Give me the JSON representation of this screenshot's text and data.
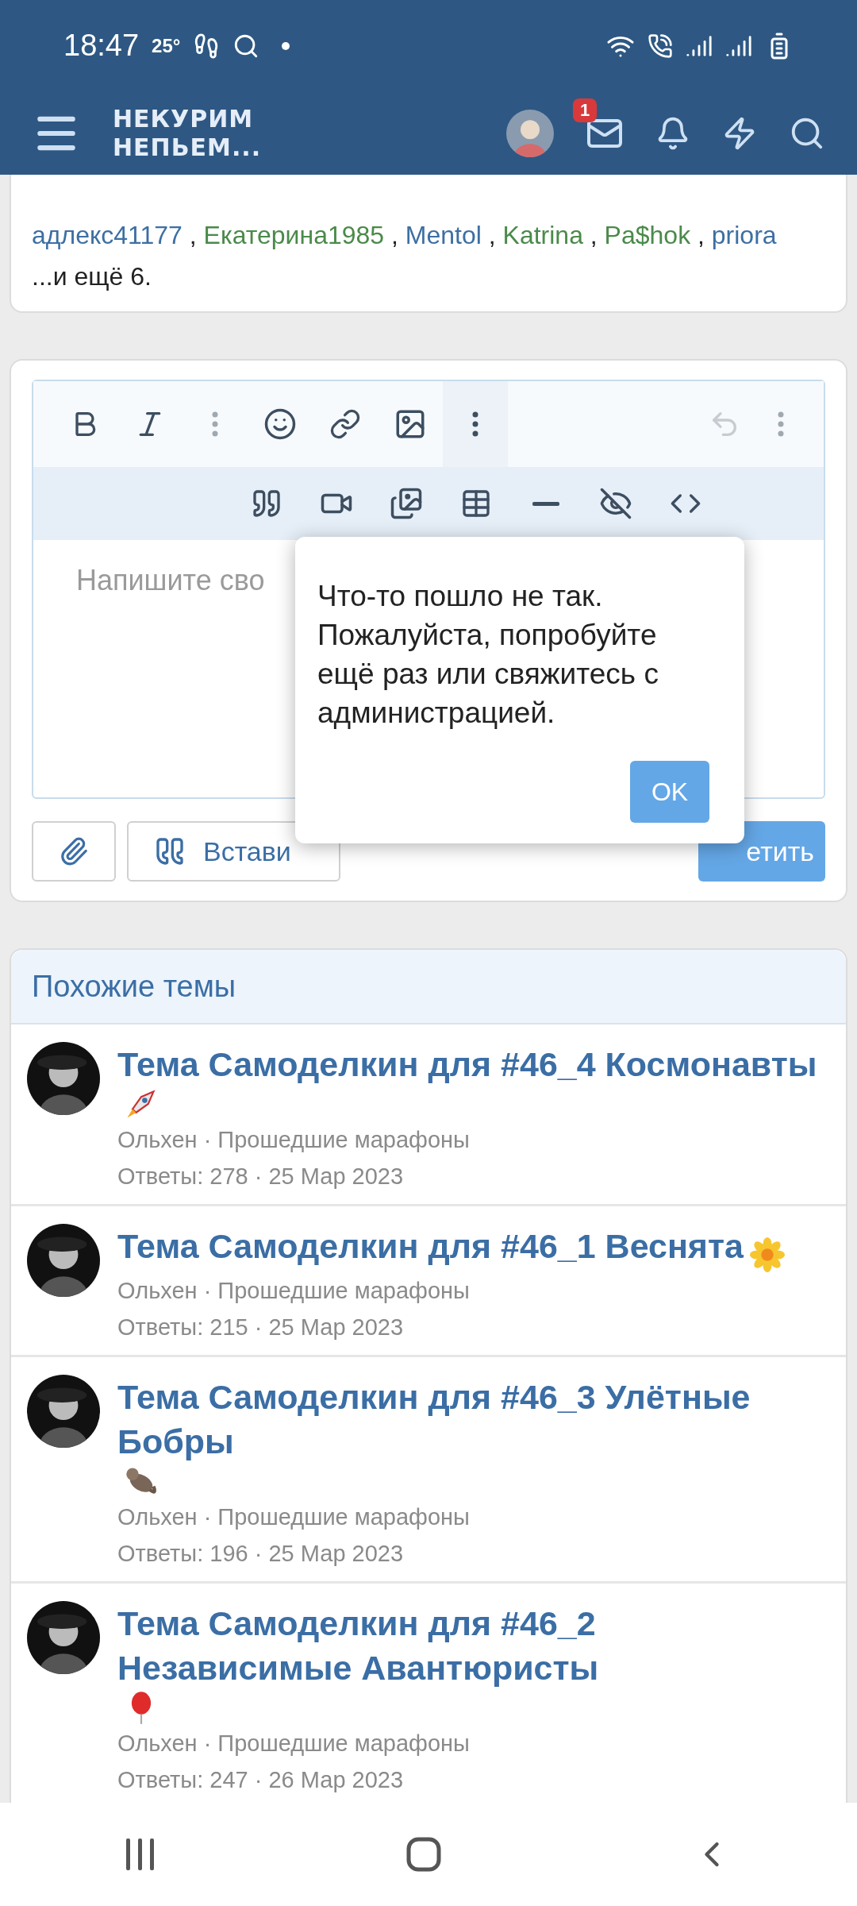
{
  "status_bar": {
    "time": "18:47",
    "temperature": "25°"
  },
  "header": {
    "logo": [
      "НЕКУРИМ",
      "НЕПЬЕМ..."
    ],
    "messages_badge": "1"
  },
  "viewers": {
    "users": [
      {
        "name": "адлекс41177",
        "color": "#3d6fa3"
      },
      {
        "name": "Екатерина1985",
        "color": "#4a8a4a"
      },
      {
        "name": "Mentol",
        "color": "#3d6fa3"
      },
      {
        "name": "Katrina",
        "color": "#4a8a4a"
      },
      {
        "name": "Pa$hok",
        "color": "#4a8a4a"
      },
      {
        "name": "priora",
        "color": "#3d6fa3"
      }
    ],
    "separator": ",",
    "more": "...и ещё 6."
  },
  "editor": {
    "more_open": true,
    "placeholder": "Напишите сво",
    "attach_label": "Встави",
    "reply_label": "етить"
  },
  "dialog": {
    "message": "Что-то пошло не так. Пожалуйста, попробуйте ещё раз или свяжитесь с администрацией.",
    "ok": "OK"
  },
  "similar": {
    "title": "Похожие темы",
    "threads": [
      {
        "title": "Тема Самоделкин для #46_4 Космонавты",
        "meta": "Ольхен · Прошедшие марафоны",
        "stats": "Ответы: 278 · 25 Мар 2023"
      },
      {
        "title": "Тема Самоделкин для #46_1 Веснята",
        "meta": "Ольхен · Прошедшие марафоны",
        "stats": "Ответы: 215 · 25 Мар 2023"
      },
      {
        "title": "Тема Самоделкин для #46_3 Улётные Бобры",
        "meta": "Ольхен · Прошедшие марафоны",
        "stats": "Ответы: 196 · 25 Мар 2023"
      },
      {
        "title": "Тема Самоделкин для #46_2 Независимые Авантюристы",
        "meta": "Ольхен · Прошедшие марафоны",
        "stats": "Ответы: 247 · 26 Мар 2023"
      }
    ]
  }
}
